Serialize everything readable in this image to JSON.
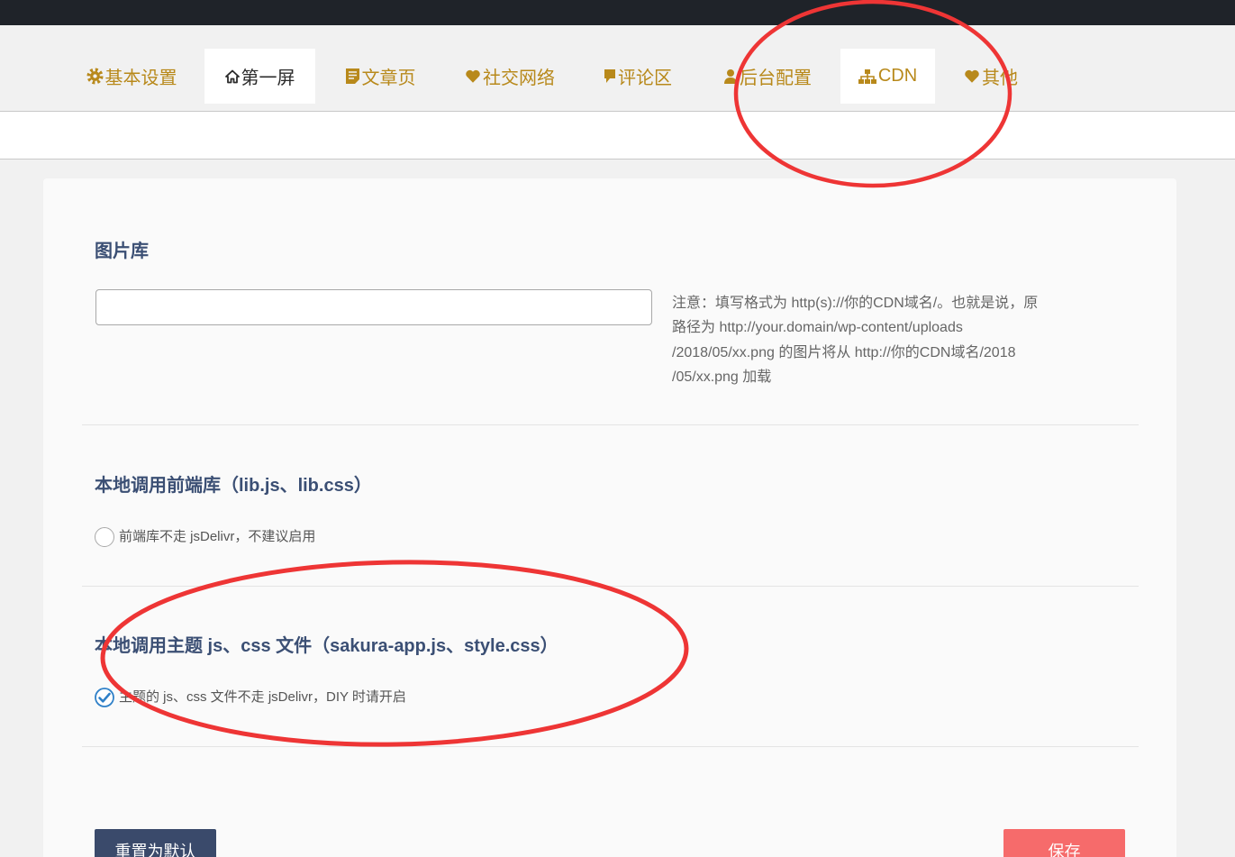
{
  "tabs": [
    {
      "label": "基本设置",
      "icon": "gear-icon"
    },
    {
      "label": "第一屏",
      "icon": "home-icon",
      "active": true
    },
    {
      "label": "文章页",
      "icon": "document-icon"
    },
    {
      "label": "社交网络",
      "icon": "heart-icon"
    },
    {
      "label": "评论区",
      "icon": "comment-icon"
    },
    {
      "label": "后台配置",
      "icon": "user-icon"
    },
    {
      "label": "CDN",
      "icon": "sitemap-icon",
      "highlighted": true
    },
    {
      "label": "其他",
      "icon": "heart-icon"
    }
  ],
  "sections": [
    {
      "title": "图片库",
      "input_value": "",
      "description_lines": [
        "注意：填写格式为 http(s)://你的CDN域名/。也就是说，原",
        "路径为 http://your.domain/wp-content/uploads",
        "/2018/05/xx.png 的图片将从 http://你的CDN域名/2018",
        "/05/xx.png 加载"
      ]
    },
    {
      "title": "本地调用前端库（lib.js、lib.css）",
      "option_label": "前端库不走 jsDelivr，不建议启用",
      "checked": false
    },
    {
      "title": "本地调用主题 js、css 文件（sakura-app.js、style.css）",
      "option_label": "主题的 js、css 文件不走 jsDelivr，DIY 时请开启",
      "checked": true
    }
  ],
  "buttons": {
    "reset_label": "重置为默认",
    "save_label": "保存"
  },
  "colors": {
    "top_bar": "#1f2329",
    "tab_gold": "#b8891b",
    "heading_blue": "#3b4f74",
    "check_blue": "#2f80c8",
    "reset_button": "#3a4a6b",
    "save_button": "#f66b6b",
    "annotation_red": "#ee3535"
  }
}
